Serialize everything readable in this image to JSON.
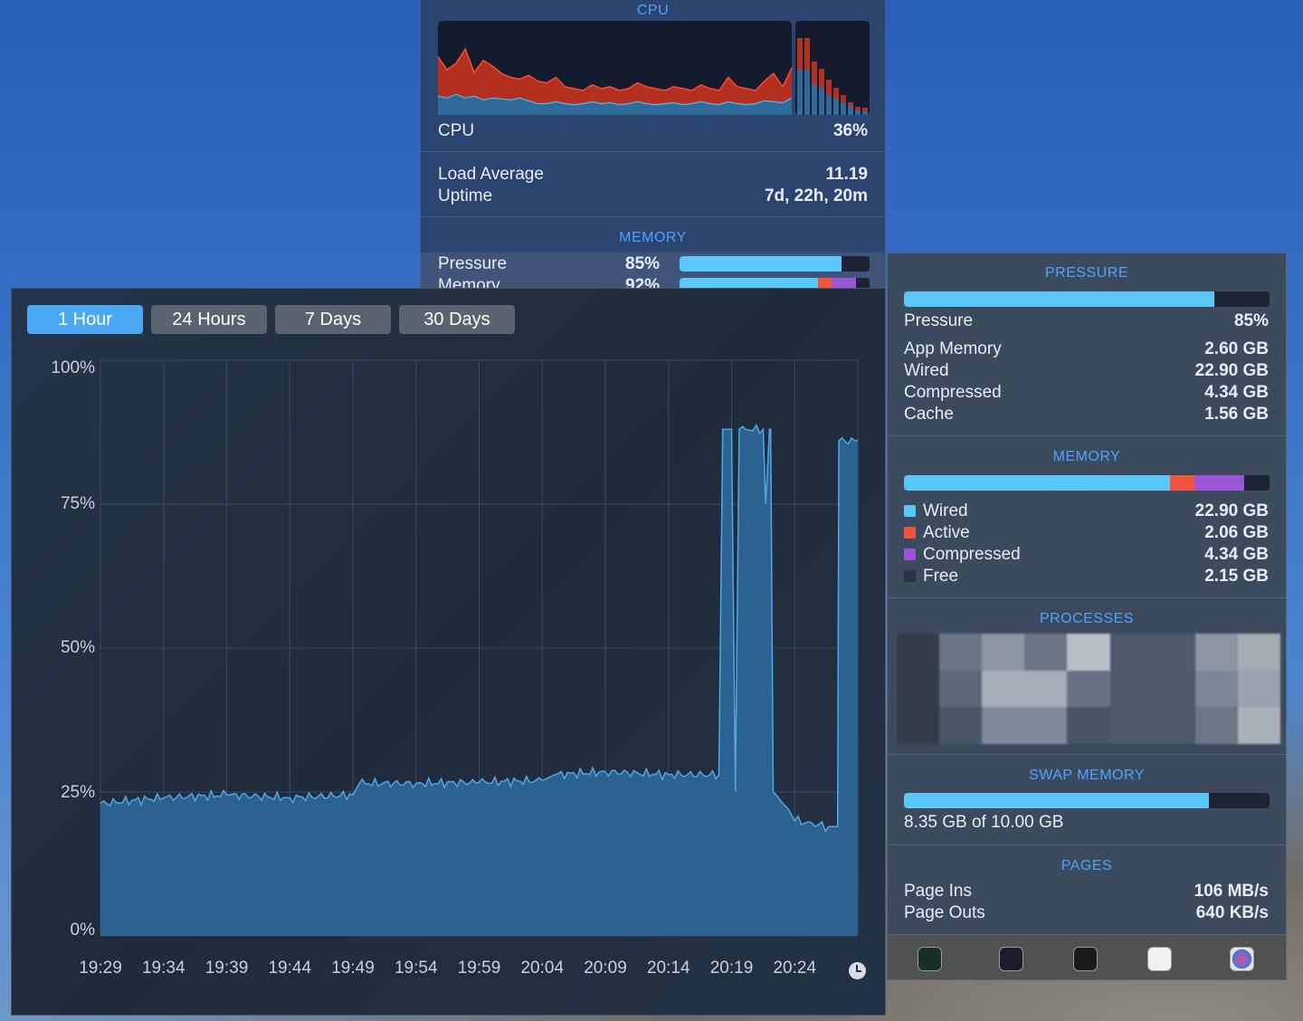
{
  "cpu": {
    "section_title": "CPU",
    "label": "CPU",
    "value": "36%",
    "history_system": [
      62,
      48,
      55,
      70,
      45,
      58,
      52,
      44,
      40,
      38,
      42,
      36,
      34,
      40,
      30,
      28,
      26,
      32,
      28,
      30,
      26,
      28,
      34,
      30,
      28,
      26,
      30,
      28,
      26,
      32,
      28,
      26,
      40,
      30,
      28,
      26,
      36,
      44,
      30,
      50
    ],
    "history_user": [
      20,
      18,
      22,
      18,
      20,
      16,
      18,
      17,
      16,
      18,
      15,
      12,
      12,
      14,
      12,
      11,
      12,
      14,
      12,
      13,
      11,
      12,
      14,
      12,
      11,
      12,
      13,
      11,
      12,
      14,
      12,
      11,
      14,
      12,
      11,
      12,
      15,
      14,
      13,
      18
    ],
    "core_bars": [
      {
        "user": 50,
        "system": 35
      },
      {
        "user": 50,
        "system": 35
      },
      {
        "user": 34,
        "system": 25
      },
      {
        "user": 30,
        "system": 21
      },
      {
        "user": 22,
        "system": 17
      },
      {
        "user": 18,
        "system": 12
      },
      {
        "user": 14,
        "system": 8
      },
      {
        "user": 10,
        "system": 4
      },
      {
        "user": 5,
        "system": 4
      },
      {
        "user": 4,
        "system": 4
      }
    ],
    "load_average_label": "Load Average",
    "load_average": "11.19",
    "uptime_label": "Uptime",
    "uptime": "7d, 22h, 20m"
  },
  "memory_small": {
    "section_title": "MEMORY",
    "pressure_label": "Pressure",
    "pressure_value": "85%",
    "pressure_fraction": 0.85,
    "memory_label": "Memory",
    "memory_value": "92%"
  },
  "right": {
    "pressure_title": "PRESSURE",
    "pressure_label": "Pressure",
    "pressure_value": "85%",
    "pressure_fraction": 0.85,
    "stats": [
      {
        "label": "App Memory",
        "value": "2.60 GB"
      },
      {
        "label": "Wired",
        "value": "22.90 GB"
      },
      {
        "label": "Compressed",
        "value": "4.34 GB"
      },
      {
        "label": "Cache",
        "value": "1.56 GB"
      }
    ],
    "memory_title": "MEMORY",
    "memory_breakdown": [
      {
        "label": "Wired",
        "value": "22.90 GB",
        "gb": 22.9,
        "color": "#5ac8fa"
      },
      {
        "label": "Active",
        "value": "2.06 GB",
        "gb": 2.06,
        "color": "#f2553d"
      },
      {
        "label": "Compressed",
        "value": "4.34 GB",
        "gb": 4.34,
        "color": "#9b55d6"
      },
      {
        "label": "Free",
        "value": "2.15 GB",
        "gb": 2.15,
        "color": "#1c2433"
      }
    ],
    "processes_title": "PROCESSES",
    "swap_title": "SWAP MEMORY",
    "swap_text": "8.35 GB of 10.00 GB",
    "swap_fraction": 0.835,
    "pages_title": "PAGES",
    "page_ins_label": "Page Ins",
    "page_ins": "106 MB/s",
    "page_outs_label": "Page Outs",
    "page_outs": "640 KB/s",
    "dock": [
      "activity-monitor-icon",
      "console-icon",
      "terminal-icon",
      "system-information-icon",
      "istat-menus-icon"
    ]
  },
  "tabs": [
    {
      "label": "1 Hour"
    },
    {
      "label": "24 Hours"
    },
    {
      "label": "7 Days"
    },
    {
      "label": "30 Days"
    }
  ],
  "chart_data": {
    "type": "area",
    "title": "Memory Pressure",
    "ylim": [
      0,
      100
    ],
    "yticks": [
      "100%",
      "75%",
      "50%",
      "25%",
      "0%"
    ],
    "xticks": [
      "19:29",
      "19:34",
      "19:39",
      "19:44",
      "19:49",
      "19:54",
      "19:59",
      "20:04",
      "20:09",
      "20:14",
      "20:19",
      "20:24"
    ],
    "x_minutes_from_1929": [
      0,
      5,
      10,
      15,
      20,
      20.5,
      25,
      30,
      35,
      36,
      40,
      45,
      49,
      49.3,
      50,
      50.3,
      50.6,
      52.5,
      52.7,
      53,
      53.1,
      53.3,
      54.5,
      55,
      57.7,
      58.4,
      58.5,
      60
    ],
    "values": [
      23,
      24,
      24.5,
      24,
      24.5,
      26.5,
      26.5,
      26.7,
      27,
      28,
      28.5,
      28,
      28,
      88,
      88,
      25,
      88,
      88,
      75,
      88,
      88,
      25,
      22,
      20,
      19,
      19,
      86,
      86
    ],
    "color": "#4ea8e8"
  }
}
